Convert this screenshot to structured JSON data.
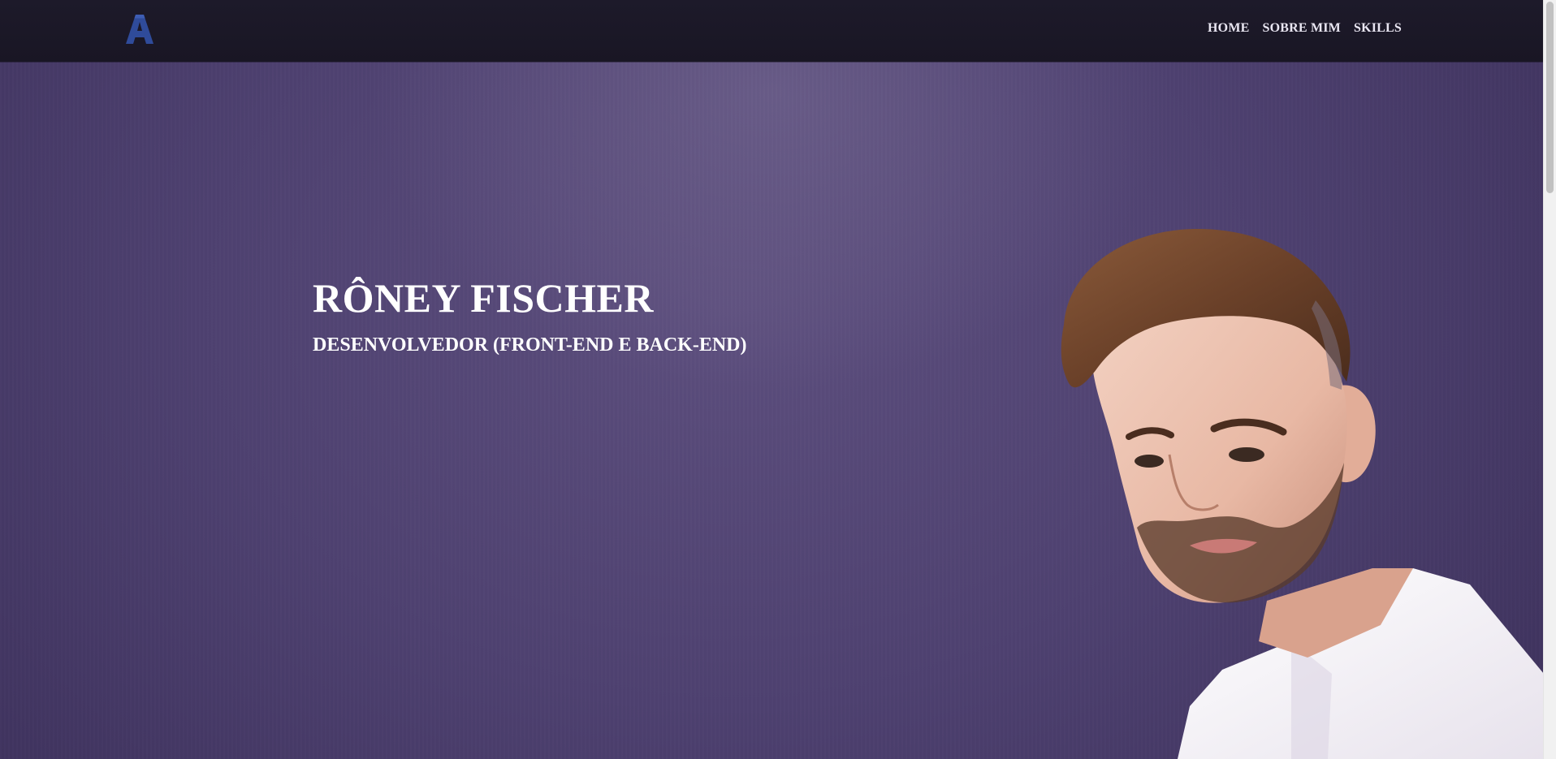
{
  "nav": {
    "logo_alt": "A",
    "links": [
      {
        "label": "HOME"
      },
      {
        "label": "SOBRE MIM"
      },
      {
        "label": "SKILLS"
      }
    ]
  },
  "hero": {
    "title": "RÔNEY FISCHER",
    "subtitle": "DESENVOLVEDOR (FRONT-END E BACK-END)"
  },
  "colors": {
    "navbar": "#1b1827",
    "hero_background": "#4e4170",
    "logo": "#2f4b9a",
    "text": "#ffffff"
  },
  "icons": {
    "logo": "letter-a-logo-icon",
    "portrait": "person-portrait"
  }
}
